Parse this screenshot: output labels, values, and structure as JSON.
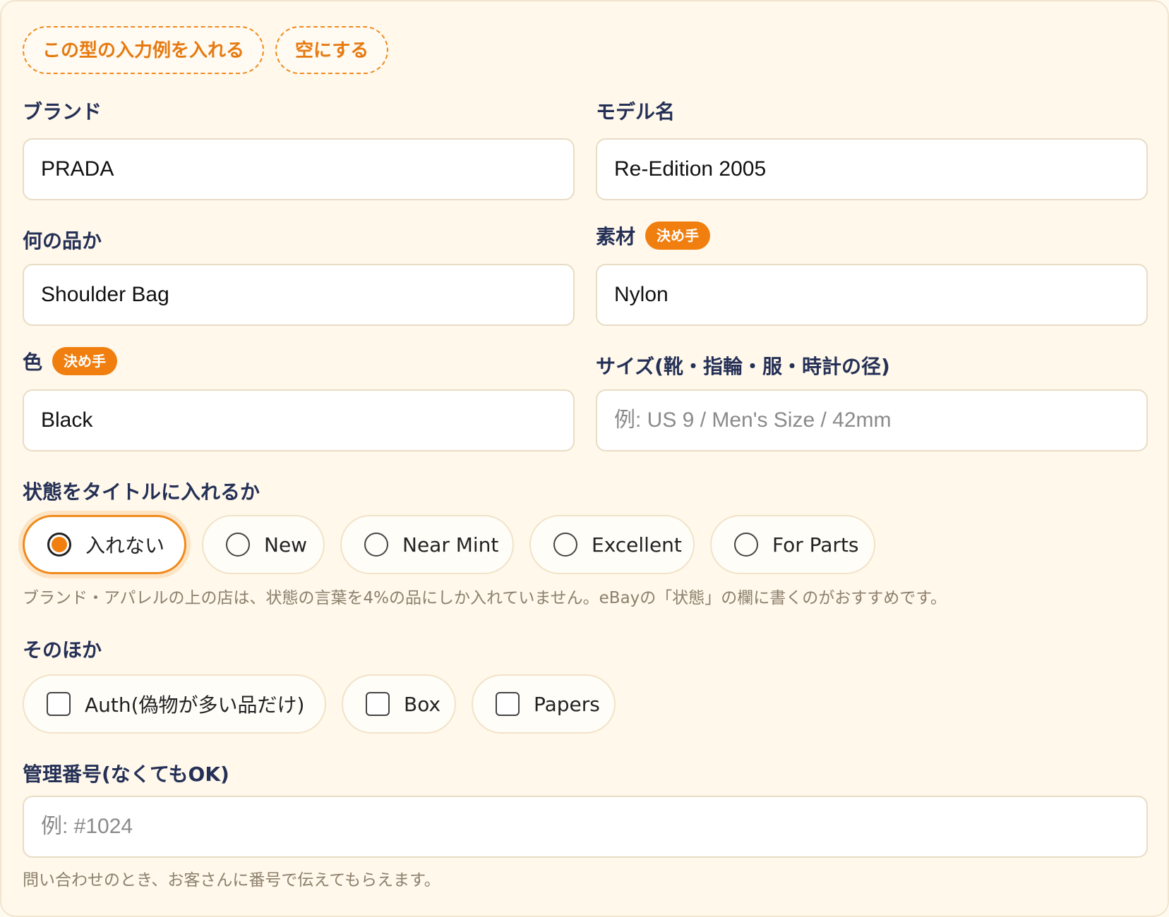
{
  "actions": {
    "fill_example": "この型の入力例を入れる",
    "clear": "空にする"
  },
  "fields": {
    "brand": {
      "label": "ブランド",
      "value": "PRADA",
      "placeholder": ""
    },
    "model": {
      "label": "モデル名",
      "value": "Re-Edition 2005",
      "placeholder": ""
    },
    "item": {
      "label": "何の品か",
      "value": "Shoulder Bag",
      "placeholder": ""
    },
    "material": {
      "label": "素材",
      "badge": "決め手",
      "value": "Nylon",
      "placeholder": ""
    },
    "color": {
      "label": "色",
      "badge": "決め手",
      "value": "Black",
      "placeholder": ""
    },
    "size": {
      "label": "サイズ(靴・指輪・服・時計の径)",
      "value": "",
      "placeholder": "例: US 9 / Men's Size / 42mm"
    },
    "manage_no": {
      "label": "管理番号(なくてもOK)",
      "value": "",
      "placeholder": "例: #1024",
      "hint": "問い合わせのとき、お客さんに番号で伝えてもらえます。"
    }
  },
  "condition": {
    "label": "状態をタイトルに入れるか",
    "options": [
      "入れない",
      "New",
      "Near Mint",
      "Excellent",
      "For Parts"
    ],
    "selected": "入れない",
    "hint": "ブランド・アパレルの上の店は、状態の言葉を4%の品にしか入れていません。eBayの「状態」の欄に書くのがおすすめです。"
  },
  "extras": {
    "label": "そのほか",
    "options": [
      "Auth(偽物が多い品だけ)",
      "Box",
      "Papers"
    ]
  }
}
